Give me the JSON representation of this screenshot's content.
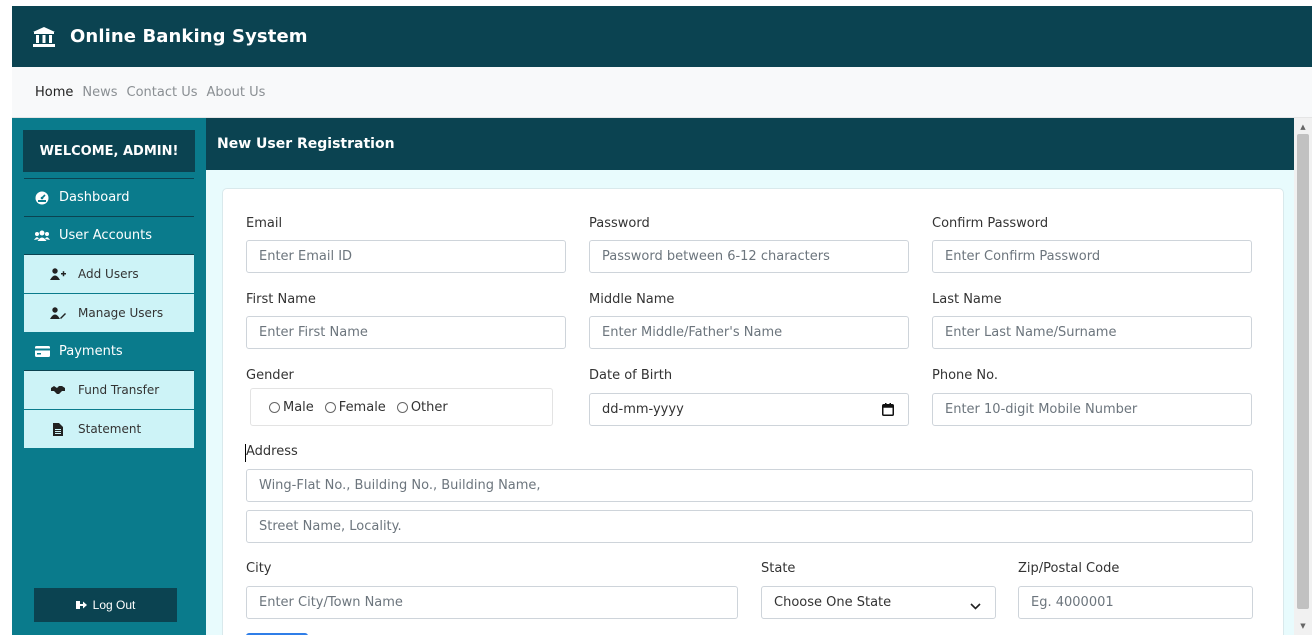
{
  "app": {
    "title": "Online Banking System",
    "brand_icon": "bank-icon",
    "colors": {
      "primary_dark": "#0b4351",
      "sidebar": "#0a7b8c",
      "submenu": "#cdf3f7",
      "content_bg": "#e8fbfd"
    }
  },
  "nav": {
    "links": [
      {
        "label": "Home"
      },
      {
        "label": "News"
      },
      {
        "label": "Contact Us"
      },
      {
        "label": "About Us"
      }
    ]
  },
  "sidebar": {
    "welcome": "WELCOME, ADMIN!",
    "dashboard": {
      "label": "Dashboard",
      "icon": "dashboard-icon"
    },
    "user_accounts": {
      "label": "User Accounts",
      "icon": "users-icon"
    },
    "add_users": {
      "label": "Add Users",
      "icon": "user-plus-icon"
    },
    "manage_users": {
      "label": "Manage Users",
      "icon": "user-edit-icon"
    },
    "payments": {
      "label": "Payments",
      "icon": "credit-card-icon"
    },
    "fund_transfer": {
      "label": "Fund Transfer",
      "icon": "handshake-icon"
    },
    "statement": {
      "label": "Statement",
      "icon": "file-icon"
    },
    "logout": {
      "label": "Log Out",
      "icon": "sign-out-icon"
    }
  },
  "main": {
    "title": "New User Registration",
    "form": {
      "email": {
        "label": "Email",
        "placeholder": "Enter Email ID"
      },
      "password": {
        "label": "Password",
        "placeholder": "Password between 6-12 characters"
      },
      "confirm_password": {
        "label": "Confirm Password",
        "placeholder": "Enter Confirm Password"
      },
      "first_name": {
        "label": "First Name",
        "placeholder": "Enter First Name"
      },
      "middle_name": {
        "label": "Middle Name",
        "placeholder": "Enter Middle/Father's Name"
      },
      "last_name": {
        "label": "Last Name",
        "placeholder": "Enter Last Name/Surname"
      },
      "gender": {
        "label": "Gender",
        "options": [
          "Male",
          "Female",
          "Other"
        ]
      },
      "dob": {
        "label": "Date of Birth",
        "value": "dd-mm-yyyy"
      },
      "phone": {
        "label": "Phone No.",
        "placeholder": "Enter 10-digit Mobile Number"
      },
      "address": {
        "label": "Address",
        "line1_placeholder": "Wing-Flat No., Building No., Building Name,",
        "line2_placeholder": "Street Name, Locality."
      },
      "city": {
        "label": "City",
        "placeholder": "Enter City/Town Name"
      },
      "state": {
        "label": "State",
        "selected": "Choose One State"
      },
      "zip": {
        "label": "Zip/Postal Code",
        "placeholder": "Eg. 4000001"
      }
    }
  }
}
